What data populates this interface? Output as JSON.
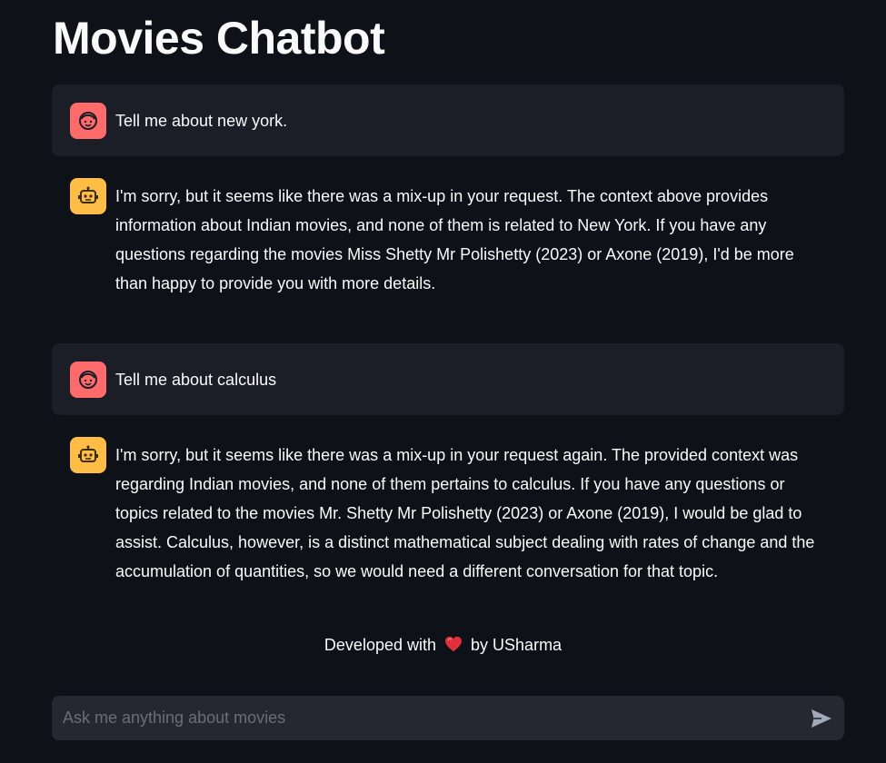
{
  "page": {
    "title": "Movies Chatbot"
  },
  "messages": [
    {
      "role": "user",
      "avatar_icon": "user-face-icon",
      "text": "Tell me about new york."
    },
    {
      "role": "assistant",
      "avatar_icon": "robot-icon",
      "text": "I'm sorry, but it seems like there was a mix-up in your request. The context above provides information about Indian movies, and none of them is related to New York. If you have any questions regarding the movies Miss Shetty Mr Polishetty (2023) or Axone (2019), I'd be more than happy to provide you with more details."
    },
    {
      "role": "user",
      "avatar_icon": "user-face-icon",
      "text": "Tell me about calculus"
    },
    {
      "role": "assistant",
      "avatar_icon": "robot-icon",
      "text": "I'm sorry, but it seems like there was a mix-up in your request again. The provided context was regarding Indian movies, and none of them pertains to calculus. If you have any questions or topics related to the movies Mr. Shetty Mr Polishetty (2023) or Axone (2019), I would be glad to assist. Calculus, however, is a distinct mathematical subject dealing with rates of change and the accumulation of quantities, so we would need a different conversation for that topic."
    }
  ],
  "footer": {
    "prefix": "Developed with",
    "heart_icon": "heart-icon",
    "suffix": "by USharma"
  },
  "chat_input": {
    "placeholder": "Ask me anything about movies",
    "value": "",
    "send_icon": "send-icon"
  },
  "colors": {
    "background": "#0e1117",
    "user_message_bg": "#1b1e26",
    "user_avatar": "#ff6b6b",
    "assistant_avatar": "#ffbd45",
    "input_bg": "#262730",
    "heart": "#e0313a"
  }
}
